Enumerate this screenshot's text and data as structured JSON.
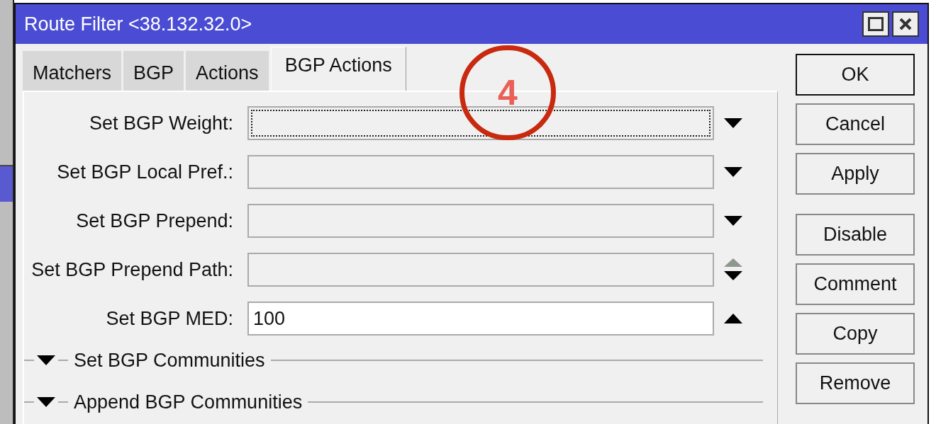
{
  "window": {
    "title": "Route Filter <38.132.32.0>"
  },
  "tabs": [
    {
      "label": "Matchers",
      "selected": false
    },
    {
      "label": "BGP",
      "selected": false
    },
    {
      "label": "Actions",
      "selected": false
    },
    {
      "label": "BGP Actions",
      "selected": true
    }
  ],
  "fields": [
    {
      "label": "Set BGP Weight:",
      "kind": "dropdown",
      "focused": true,
      "enabled": false
    },
    {
      "label": "Set BGP Local Pref.:",
      "kind": "dropdown",
      "focused": false,
      "enabled": false
    },
    {
      "label": "Set BGP Prepend:",
      "kind": "dropdown",
      "focused": false,
      "enabled": false
    },
    {
      "label": "Set BGP Prepend Path:",
      "kind": "updown",
      "focused": false,
      "enabled": false
    },
    {
      "label": "Set BGP MED:",
      "kind": "collapse",
      "value": "100",
      "focused": false,
      "enabled": true
    }
  ],
  "sections": [
    {
      "label": "Set BGP Communities",
      "expanded": false
    },
    {
      "label": "Append BGP Communities",
      "expanded": false
    }
  ],
  "buttons": [
    {
      "label": "OK",
      "default": true,
      "group_start": false
    },
    {
      "label": "Cancel",
      "default": false,
      "group_start": false
    },
    {
      "label": "Apply",
      "default": false,
      "group_start": false
    },
    {
      "label": "Disable",
      "default": false,
      "group_start": true
    },
    {
      "label": "Comment",
      "default": false,
      "group_start": false
    },
    {
      "label": "Copy",
      "default": false,
      "group_start": false
    },
    {
      "label": "Remove",
      "default": false,
      "group_start": false
    }
  ],
  "callout": {
    "label": "4"
  }
}
